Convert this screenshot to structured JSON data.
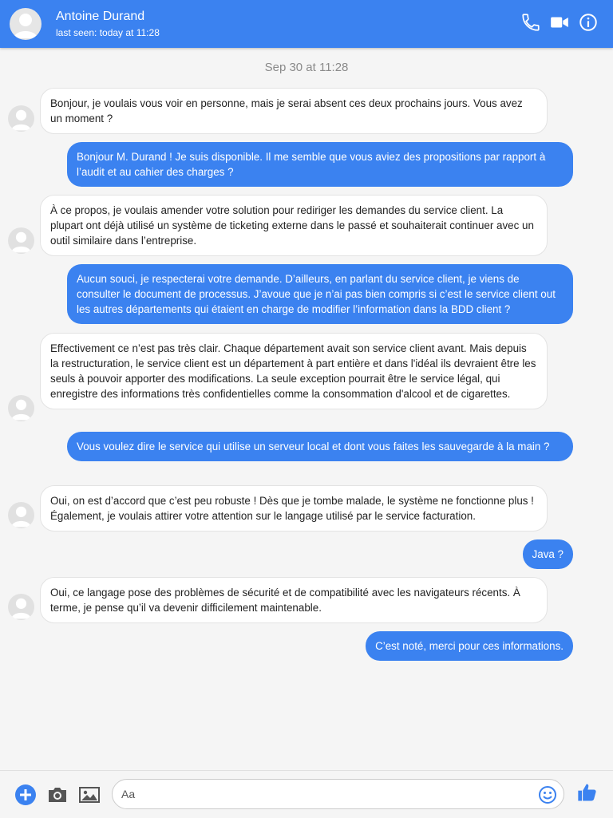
{
  "header": {
    "contact_name": "Antoine Durand",
    "status": "last seen: today at 11:28",
    "icons": [
      "phone-icon",
      "video-camera-icon",
      "info-icon"
    ]
  },
  "conversation": {
    "date_label": "Sep 30 at 11:28",
    "messages": [
      {
        "direction": "incoming",
        "text": "Bonjour, je voulais vous voir en personne, mais je serai absent ces deux prochains jours. Vous avez un moment ?"
      },
      {
        "direction": "outgoing",
        "text": "Bonjour M. Durand ! Je suis disponible. Il me semble que vous aviez des propositions par rapport à l’audit et au cahier des charges ?"
      },
      {
        "direction": "incoming",
        "text": "À ce propos, je voulais amender votre solution pour rediriger les demandes du service client. La plupart ont déjà utilisé un système de ticketing externe dans le passé et souhaiterait continuer avec un outil similaire dans l’entreprise."
      },
      {
        "direction": "outgoing",
        "text": "Aucun souci, je respecterai votre demande. D’ailleurs, en parlant du service client, je viens de consulter le document de processus. J’avoue que je n’ai pas bien compris si c’est le service client out les autres départements qui étaient en charge de modifier l’information dans la BDD client ?"
      },
      {
        "direction": "incoming",
        "text": "Effectivement ce n’est pas très clair. Chaque département avait son service client avant. Mais depuis la restructuration, le service client est un département à part entière et dans l'idéal ils devraient être les seuls à pouvoir apporter des modifications. La seule exception pourrait être le service légal, qui enregistre des informations très confidentielles comme la consommation d'alcool et de cigarettes."
      },
      {
        "direction": "outgoing",
        "text": "Vous voulez dire le service qui utilise un serveur local et dont vous faites les sauvegarde à la main ?"
      },
      {
        "direction": "incoming",
        "text": "Oui, on est d’accord que c’est peu robuste ! Dès que je tombe malade, le système ne fonctionne plus ! Également, je voulais attirer votre attention sur le langage utilisé par le service facturation."
      },
      {
        "direction": "outgoing",
        "text": "Java ?"
      },
      {
        "direction": "incoming",
        "text": "Oui, ce langage pose des problèmes de sécurité et de compatibilité avec les navigateurs récents. À terme, je pense qu’il va devenir difficilement maintenable."
      },
      {
        "direction": "outgoing",
        "text": "C’est noté, merci pour ces informations."
      }
    ]
  },
  "composer": {
    "placeholder": "Aa",
    "icons": [
      "plus-icon",
      "camera-icon",
      "image-icon",
      "emoji-icon",
      "thumbs-up-icon"
    ]
  },
  "colors": {
    "accent": "#3b82f0",
    "background": "#f5f5f5",
    "incoming_bubble": "#ffffff"
  }
}
